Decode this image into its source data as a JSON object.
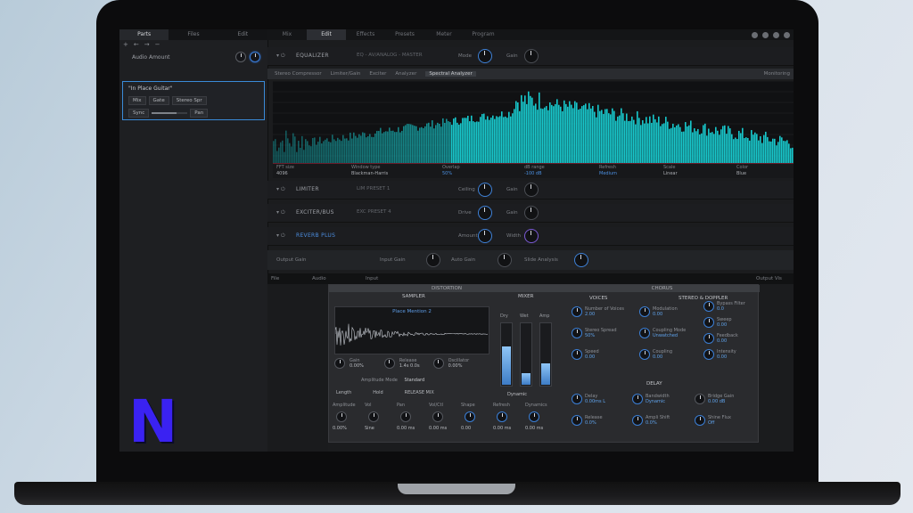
{
  "left_panel": {
    "tabs": [
      "Parts",
      "Files",
      "Edit"
    ],
    "tool_icons": [
      "+",
      "←",
      "→",
      "−"
    ],
    "row1_label": "Audio Amount",
    "module_card": {
      "name": "\"In Place Guitar\"",
      "field1": "Mix",
      "field2": "Gate",
      "field3": "Stereo Spr",
      "field4": "Sync",
      "field5": "Pan"
    }
  },
  "topbar": {
    "tabs": [
      "Mix",
      "Edit",
      "Effects",
      "Presets",
      "Meter",
      "Program"
    ],
    "active_index": 1
  },
  "modules": {
    "equalizer": {
      "title": "EQUALIZER",
      "preset": "EQ - AV/ANALOG - MASTER",
      "lab1": "Mode",
      "lab2": "Gain"
    },
    "limiter": {
      "title": "LIMITER",
      "preset": "LIM PRESET 1",
      "lab1": "Ceiling",
      "lab2": "Gain"
    },
    "exciter": {
      "title": "EXCITER/BUS",
      "preset": "EXC PRESET 4",
      "lab1": "Drive",
      "lab2": "Gain"
    },
    "reverb": {
      "title": "REVERB PLUS",
      "preset": "",
      "lab1": "Amount",
      "lab2": "Width"
    }
  },
  "subbar": {
    "items": [
      "Stereo Compressor",
      "Limiter/Gain",
      "Exciter",
      "Analyzer",
      "Spectral Analyzer"
    ],
    "selected_index": 4,
    "right_label": "Monitoring"
  },
  "spectrum_params": [
    {
      "label": "FFT size",
      "value": "4096",
      "blue": false
    },
    {
      "label": "Window type",
      "value": "Blackman-Harris",
      "blue": false
    },
    {
      "label": "Overlap",
      "value": "50%",
      "blue": true
    },
    {
      "label": "dB range",
      "value": "-100 dB",
      "blue": true
    },
    {
      "label": "Refresh",
      "value": "Medium",
      "blue": true
    },
    {
      "label": "Scale",
      "value": "Linear",
      "blue": false
    },
    {
      "label": "Color",
      "value": "Blue",
      "blue": false
    }
  ],
  "pane_bar": {
    "labels": [
      "Output Gain",
      "Input Gain",
      "Auto Gain",
      "Slide Analysis"
    ]
  },
  "tool_strip": {
    "labels": [
      "File",
      "Audio",
      "Input",
      "Output Vis"
    ]
  },
  "plugin": {
    "header_left": "DISTORTION",
    "header_mid": "MIXER",
    "header_right": "CHORUS",
    "sampler_title": "SAMPLER",
    "sample_name": "Place Mention 2",
    "sampler_knobs": [
      {
        "label": "Gain",
        "value": "0.00%"
      },
      {
        "label": "Release",
        "value": "1.4s 0.0s"
      },
      {
        "label": "Oscillator",
        "value": "0.00%"
      }
    ],
    "amp_mode_label": "Amplitude Mode",
    "amp_mode_value": "Standard",
    "row_labels": [
      "Length",
      "Hold",
      "RELEASE MIX"
    ],
    "bottom_labels": [
      "Amplitude",
      "Vol",
      "Pan",
      "Vol/Ctl",
      "Shape",
      "Refresh",
      "Dynamics"
    ],
    "bottom_values": [
      "0.00%",
      "Sine",
      "0.00 ms",
      "0.00 ms",
      "0.00",
      "0.00 ms",
      "0.00 ms"
    ],
    "mixer_labels": [
      "Dry",
      "Wet",
      "Amp"
    ],
    "mixer_footer": "Dynamic",
    "chorus_sections": [
      "VOICES",
      "STEREO & DOPPLER"
    ],
    "chorus_knobs": [
      {
        "label": "Number of Voices",
        "value": "2.00"
      },
      {
        "label": "Stereo Spread",
        "value": "50%"
      },
      {
        "label": "Speed",
        "value": "0.00"
      },
      {
        "label": "Modulation",
        "value": "0.00"
      },
      {
        "label": "Coupling Mode",
        "value": "Unwatched"
      },
      {
        "label": "Coupling",
        "value": "0.00"
      },
      {
        "label": "Bypass Filter",
        "value": "0.0"
      },
      {
        "label": "Sweep",
        "value": "0.00"
      },
      {
        "label": "Feedback",
        "value": "0.00"
      },
      {
        "label": "Intensity",
        "value": "0.00"
      }
    ],
    "delay_title": "DELAY",
    "delay_knobs": [
      {
        "label": "Delay",
        "value": "0.00ms L"
      },
      {
        "label": "Bandwidth",
        "value": "Dynamic"
      },
      {
        "label": "Bridge Gain",
        "value": "0.00 dB"
      },
      {
        "label": "Release",
        "value": "0.0%"
      },
      {
        "label": "Ampli Shift",
        "value": "0.0%"
      },
      {
        "label": "Shine Flux",
        "value": "Off"
      }
    ],
    "meter_fill": [
      0.62,
      0.18,
      0.34
    ]
  },
  "colors": {
    "accent": "#3b7fd6",
    "spectrum": "#19d3d6",
    "logo": "#3a22f2"
  },
  "logo_letter": "N"
}
